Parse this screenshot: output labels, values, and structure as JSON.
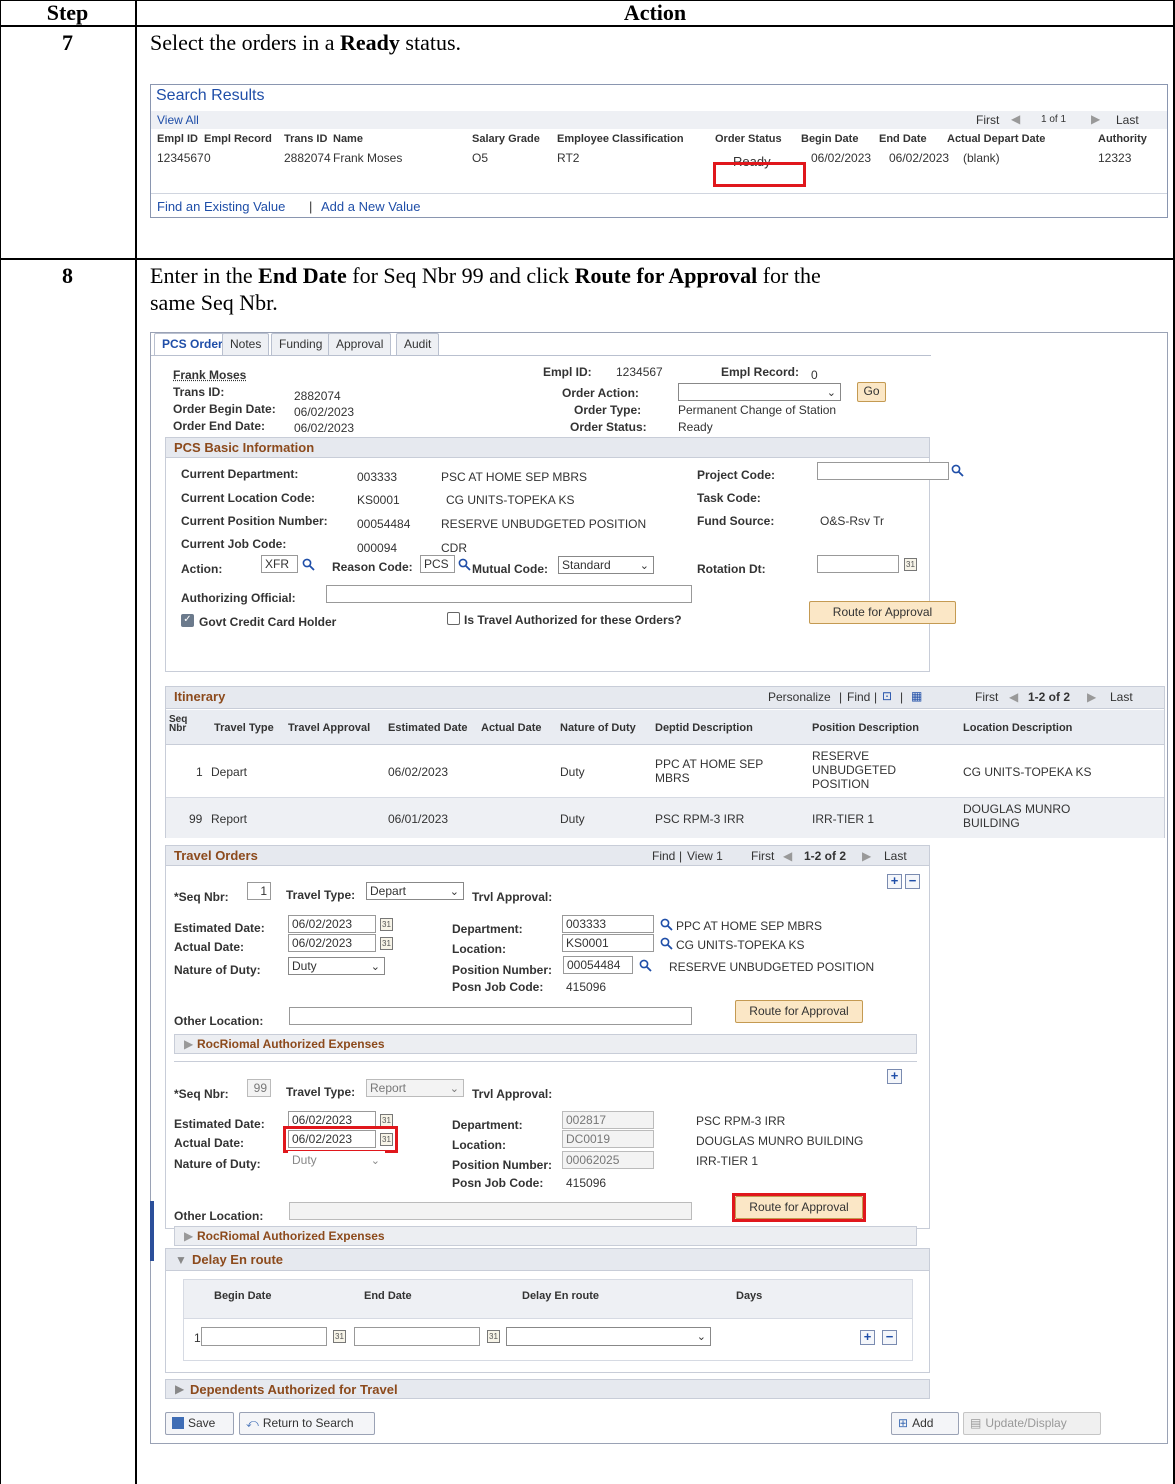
{
  "table_headers": {
    "step": "Step",
    "action": "Action"
  },
  "step7": {
    "number": "7",
    "instruction_pre": "Select the orders in a ",
    "instruction_bold": "Ready",
    "instruction_post": " status.",
    "search": {
      "title": "Search Results",
      "view_all": "View All",
      "first": "First",
      "page": "1 of 1",
      "last": "Last",
      "columns": [
        "Empl ID",
        "Empl Record",
        "Trans ID",
        "Name",
        "Salary Grade",
        "Employee Classification",
        "Order Status",
        "Begin Date",
        "End Date",
        "Actual Depart Date",
        "Authority"
      ],
      "row": [
        "1234567",
        "0",
        "2882074",
        "Frank Moses",
        "O5",
        "RT2",
        "Ready",
        "06/02/2023",
        "06/02/2023",
        "(blank)",
        "12323"
      ],
      "find_existing": "Find an Existing Value",
      "separator": "|",
      "add_new": "Add a New Value"
    }
  },
  "step8": {
    "number": "8",
    "instr_a": "Enter in the ",
    "instr_b": "End Date",
    "instr_c": " for Seq Nbr 99 and click ",
    "instr_d": "Route for Approval",
    "instr_e": " for the",
    "instr_line2": "same Seq Nbr.",
    "tabs": [
      "PCS Order",
      "Notes",
      "Funding",
      "Approval",
      "Audit"
    ],
    "header": {
      "name": "Frank Moses",
      "trans_id_label": "Trans ID:",
      "trans_id": "2882074",
      "begin_label": "Order Begin Date:",
      "begin": "06/02/2023",
      "end_label": "Order End Date:",
      "end": "06/02/2023",
      "emplid_label": "Empl ID:",
      "emplid": "1234567",
      "emplrec_label": "Empl Record:",
      "emplrec": "0",
      "action_label": "Order Action:",
      "go": "Go",
      "type_label": "Order Type:",
      "type": "Permanent Change of Station",
      "status_label": "Order Status:",
      "status": "Ready"
    },
    "basic": {
      "title": "PCS Basic Information",
      "dept_label": "Current Department:",
      "dept": "003333",
      "dept_desc": "PSC AT HOME SEP MBRS",
      "loc_label": "Current Location Code:",
      "loc": "KS0001",
      "loc_desc": "CG UNITS-TOPEKA KS",
      "pos_label": "Current Position Number:",
      "pos": "00054484",
      "pos_desc": "RESERVE UNBUDGETED POSITION",
      "job_label": "Current Job Code:",
      "job": "000094",
      "job_desc": "CDR",
      "project_label": "Project Code:",
      "task_label": "Task Code:",
      "fund_label": "Fund Source:",
      "fund": "O&S-Rsv Tr",
      "action_label": "Action:",
      "action": "XFR",
      "reason_label": "Reason Code:",
      "reason": "PCS",
      "mutual_label": "Mutual Code:",
      "mutual": "Standard",
      "rotation_label": "Rotation Dt:",
      "auth_label": "Authorizing Official:",
      "govt_cc": "Govt Credit Card Holder",
      "travel_auth": "Is Travel Authorized for these Orders?",
      "route": "Route for Approval"
    },
    "itinerary": {
      "title": "Itinerary",
      "personalize": "Personalize",
      "find": "Find",
      "sep": "|",
      "first": "First",
      "range": "1-2 of 2",
      "last": "Last",
      "columns": [
        "Seq Nbr",
        "Travel Type",
        "Travel Approval",
        "Estimated Date",
        "Actual Date",
        "Nature of Duty",
        "Deptid Description",
        "Position Description",
        "Location Description"
      ],
      "rows": [
        [
          "1",
          "Depart",
          "",
          "06/02/2023",
          "",
          "Duty",
          "PPC AT HOME SEP MBRS",
          "RESERVE UNBUDGETED POSITION",
          "CG UNITS-TOPEKA KS"
        ],
        [
          "99",
          "Report",
          "",
          "06/01/2023",
          "",
          "Duty",
          "PSC RPM-3 IRR",
          "IRR-TIER 1",
          "DOUGLAS MUNRO BUILDING"
        ]
      ]
    },
    "travel_orders": {
      "title": "Travel Orders",
      "find": "Find",
      "sep": "|",
      "view": "View 1",
      "first": "First",
      "range": "1-2 of 2",
      "last": "Last",
      "seq_label": "*Seq Nbr:",
      "type_label": "Travel Type:",
      "trvl_label": "Trvl Approval:",
      "est_label": "Estimated Date:",
      "act_label": "Actual Date:",
      "nature_label": "Nature of Duty:",
      "dept_label": "Department:",
      "loc_label": "Location:",
      "pos_label": "Position Number:",
      "job_label": "Posn Job Code:",
      "other_label": "Other Location:",
      "route": "Route for Approval",
      "expenses": "RocRiomal Authorized Expenses",
      "entries": [
        {
          "seq": "1",
          "type": "Depart",
          "est": "06/02/2023",
          "act": "06/02/2023",
          "nature": "Duty",
          "dept": "003333",
          "dept_desc": "PPC AT HOME SEP MBRS",
          "loc": "KS0001",
          "loc_desc": "CG UNITS-TOPEKA KS",
          "pos": "00054484",
          "pos_desc": "RESERVE UNBUDGETED POSITION",
          "job": "415096"
        },
        {
          "seq": "99",
          "type": "Report",
          "est": "06/02/2023",
          "act": "06/02/2023",
          "nature": "Duty",
          "dept": "002817",
          "dept_desc": "PSC RPM-3 IRR",
          "loc": "DC0019",
          "loc_desc": "DOUGLAS MUNRO BUILDING",
          "pos": "00062025",
          "pos_desc": "IRR-TIER 1",
          "job": "415096"
        }
      ]
    },
    "delay": {
      "title": "Delay En route",
      "columns": [
        "Begin Date",
        "End Date",
        "Delay En route",
        "Days"
      ],
      "row_num": "1"
    },
    "dependents": "Dependents Authorized for Travel",
    "footer": {
      "save": "Save",
      "return": "Return to Search",
      "add": "Add",
      "update": "Update/Display"
    }
  }
}
